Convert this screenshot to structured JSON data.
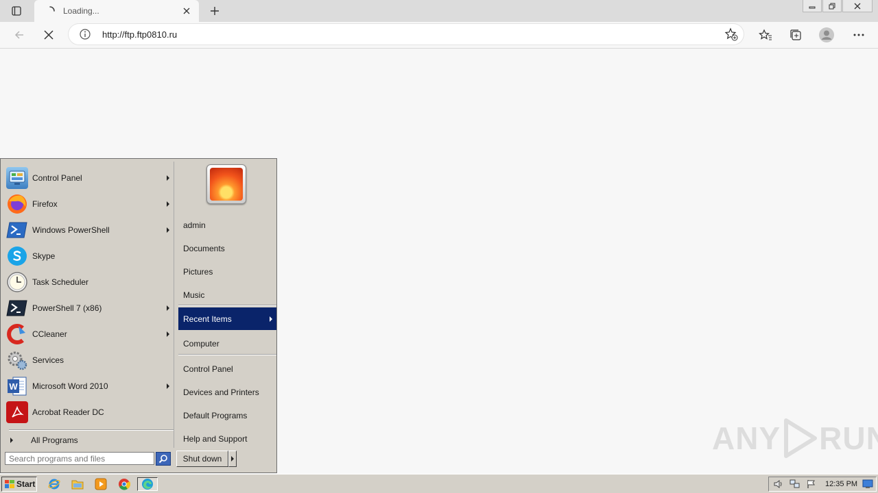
{
  "browser": {
    "tab_title": "Loading...",
    "url": "http://ftp.ftp0810.ru"
  },
  "start_menu": {
    "programs": [
      {
        "label": "Control Panel",
        "icon": "control-panel-icon",
        "has_submenu": true
      },
      {
        "label": "Firefox",
        "icon": "firefox-icon",
        "has_submenu": true
      },
      {
        "label": "Windows PowerShell",
        "icon": "powershell-icon",
        "has_submenu": true
      },
      {
        "label": "Skype",
        "icon": "skype-icon",
        "has_submenu": false
      },
      {
        "label": "Task Scheduler",
        "icon": "task-scheduler-icon",
        "has_submenu": false
      },
      {
        "label": "PowerShell 7 (x86)",
        "icon": "powershell7-icon",
        "has_submenu": true
      },
      {
        "label": "CCleaner",
        "icon": "ccleaner-icon",
        "has_submenu": true
      },
      {
        "label": "Services",
        "icon": "services-icon",
        "has_submenu": false
      },
      {
        "label": "Microsoft Word 2010",
        "icon": "word-icon",
        "has_submenu": true
      },
      {
        "label": "Acrobat Reader DC",
        "icon": "acrobat-icon",
        "has_submenu": false
      }
    ],
    "all_programs": "All Programs",
    "right_items": {
      "user": "admin",
      "documents": "Documents",
      "pictures": "Pictures",
      "music": "Music",
      "recent_items": "Recent Items",
      "computer": "Computer",
      "control_panel": "Control Panel",
      "devices_printers": "Devices and Printers",
      "default_programs": "Default Programs",
      "help_support": "Help and Support"
    },
    "search_placeholder": "Search programs and files",
    "shutdown_label": "Shut down"
  },
  "watermark": {
    "left": "ANY",
    "right": "RUN"
  },
  "taskbar": {
    "start_label": "Start",
    "clock": "12:35 PM"
  }
}
